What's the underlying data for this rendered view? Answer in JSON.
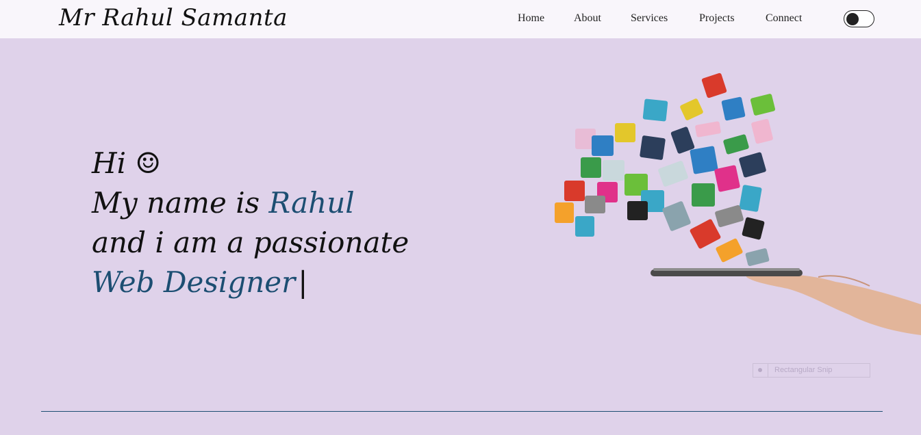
{
  "brand": {
    "name": "Mr Rahul Samanta"
  },
  "nav": {
    "items": [
      {
        "label": "Home"
      },
      {
        "label": "About"
      },
      {
        "label": "Services"
      },
      {
        "label": "Projects"
      },
      {
        "label": "Connect"
      }
    ],
    "theme_toggle": {
      "icon": "dark-mode-toggle"
    }
  },
  "hero": {
    "line1": "Hi ☺",
    "line2_prefix": "My name is ",
    "name": "Rahul",
    "line3": "and i am a passionate",
    "role": "Web Designer",
    "cursor": "|"
  },
  "overlay": {
    "snip_label": "Rectangular Snip"
  },
  "colors": {
    "accent": "#1c4e72",
    "background": "#dfd2ea",
    "navbar": "#f9f6fb"
  }
}
